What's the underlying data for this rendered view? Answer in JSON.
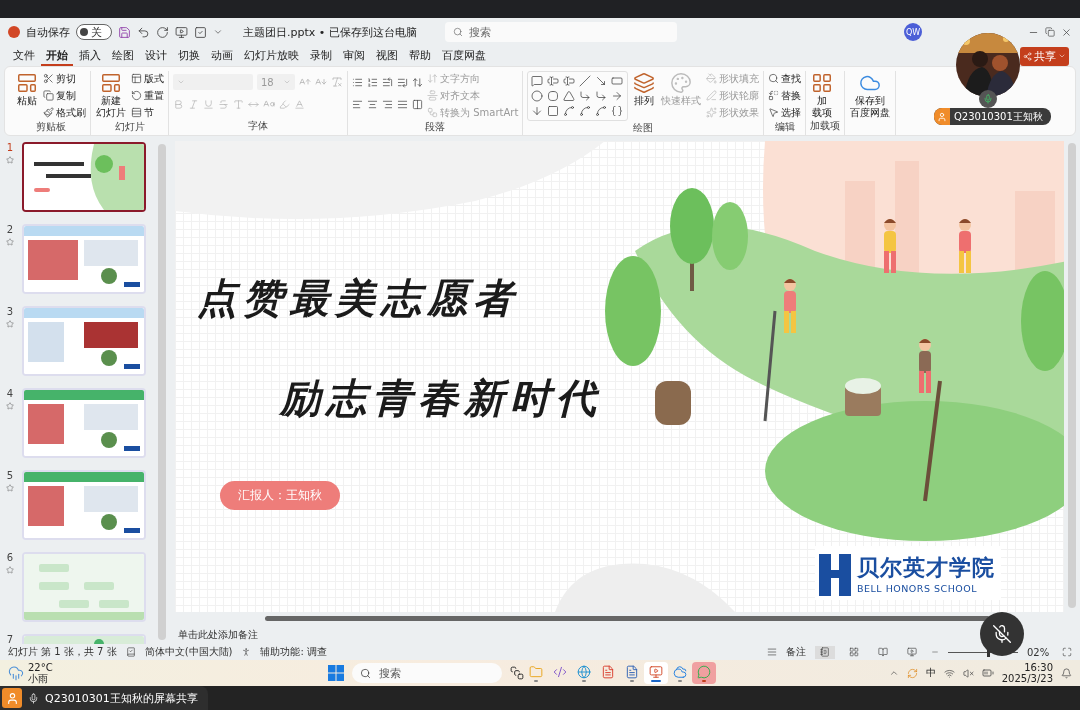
{
  "title_bar": {
    "autosave_label": "自动保存",
    "autosave": {
      "on": false,
      "label": "关"
    },
    "file_title": "主题团日.pptx • 已保存到这台电脑",
    "search_placeholder": "搜索",
    "account_initials": "QW"
  },
  "menu_tabs": [
    {
      "label": "文件",
      "selected": false
    },
    {
      "label": "开始",
      "selected": true
    },
    {
      "label": "插入",
      "selected": false
    },
    {
      "label": "绘图",
      "selected": false
    },
    {
      "label": "设计",
      "selected": false
    },
    {
      "label": "切换",
      "selected": false
    },
    {
      "label": "动画",
      "selected": false
    },
    {
      "label": "幻灯片放映",
      "selected": false
    },
    {
      "label": "录制",
      "selected": false
    },
    {
      "label": "审阅",
      "selected": false
    },
    {
      "label": "视图",
      "selected": false
    },
    {
      "label": "帮助",
      "selected": false
    },
    {
      "label": "百度网盘",
      "selected": false
    }
  ],
  "share_button": {
    "label": "共享"
  },
  "ribbon_groups": [
    {
      "kind": "clipboard",
      "title": "剪贴板",
      "large": [
        {
          "lines": [
            "粘贴"
          ],
          "disabled": false
        }
      ],
      "small": [
        {
          "label": "剪切",
          "disabled": false
        },
        {
          "label": "复制",
          "disabled": false
        },
        {
          "label": "格式刷",
          "disabled": false
        }
      ]
    },
    {
      "kind": "slides",
      "title": "幻灯片",
      "large": [
        {
          "lines": [
            "新建",
            "幻灯片"
          ],
          "disabled": false
        }
      ],
      "small": [
        {
          "label": "版式",
          "disabled": false
        },
        {
          "label": "重置",
          "disabled": false
        },
        {
          "label": "节",
          "disabled": false
        }
      ]
    },
    {
      "kind": "font",
      "title": "字体",
      "font_size": "18",
      "disabled": true
    },
    {
      "kind": "paragraph",
      "title": "段落",
      "small": [
        {
          "label": "文字方向",
          "disabled": true
        },
        {
          "label": "对齐文本",
          "disabled": true
        },
        {
          "label": "转换为 SmartArt",
          "disabled": true
        }
      ]
    },
    {
      "kind": "drawing",
      "title": "绘图",
      "large": [
        {
          "lines": [
            "排列"
          ],
          "disabled": false
        },
        {
          "lines": [
            "快速样式"
          ],
          "disabled": true
        }
      ],
      "small": [
        {
          "label": "形状填充",
          "disabled": true
        },
        {
          "label": "形状轮廓",
          "disabled": true
        },
        {
          "label": "形状效果",
          "disabled": true
        }
      ]
    },
    {
      "kind": "editing",
      "title": "编辑",
      "small": [
        {
          "label": "查找",
          "disabled": false
        },
        {
          "label": "替换",
          "disabled": false
        },
        {
          "label": "选择",
          "disabled": false
        }
      ]
    },
    {
      "kind": "addins",
      "title": "加载项",
      "large": [
        {
          "lines": [
            "加",
            "载项"
          ],
          "disabled": false
        }
      ]
    },
    {
      "kind": "baidu",
      "large": [
        {
          "lines": [
            "保存到",
            "百度网盘"
          ],
          "disabled": false
        }
      ]
    }
  ],
  "thumbnails": [
    {
      "number": "1",
      "selected": true,
      "animated": true
    },
    {
      "number": "2",
      "selected": false,
      "animated": true
    },
    {
      "number": "3",
      "selected": false,
      "animated": true
    },
    {
      "number": "4",
      "selected": false,
      "animated": true
    },
    {
      "number": "5",
      "selected": false,
      "animated": true
    },
    {
      "number": "6",
      "selected": false,
      "animated": true
    },
    {
      "number": "7",
      "selected": false
    }
  ],
  "slide": {
    "title_lines": [
      "点赞最美志愿者",
      "励志青春新时代"
    ],
    "presenter": "汇报人：王知秋",
    "school_name": "贝尔英才学院",
    "school_name_en": "BELL HONORS SCHOOL"
  },
  "notes_placeholder": "单击此处添加备注",
  "status_bar": {
    "slide_count": "幻灯片 第 1 张，共 7 张",
    "language": "简体中文(中国大陆)",
    "accessibility": "辅助功能: 调查",
    "notes": "备注",
    "views": [
      {
        "selected": true
      },
      {
        "selected": false
      },
      {
        "selected": false
      },
      {
        "selected": false
      }
    ],
    "zoom": {
      "level": 0.55,
      "reading": "02%"
    }
  },
  "taskbar": {
    "weather": {
      "temp": "22°C",
      "desc": "小雨"
    },
    "search_placeholder": "搜索",
    "apps": [
      {
        "running": true,
        "active": false,
        "flashing": false
      },
      {
        "running": false,
        "active": false,
        "flashing": false
      },
      {
        "running": true,
        "active": false,
        "flashing": false
      },
      {
        "running": false,
        "active": false,
        "flashing": false
      },
      {
        "running": true,
        "active": false,
        "flashing": false
      },
      {
        "running": true,
        "active": true,
        "flashing": false
      },
      {
        "running": true,
        "active": false,
        "flashing": false
      },
      {
        "running": true,
        "active": false,
        "flashing": true
      }
    ],
    "ime": "中",
    "time": "16:30",
    "date": "2025/3/23"
  },
  "overlays": {
    "presenter_tag": "Q23010301王知秋",
    "share_label": "Q23010301王知秋的屏幕共享",
    "mic_muted": true
  }
}
